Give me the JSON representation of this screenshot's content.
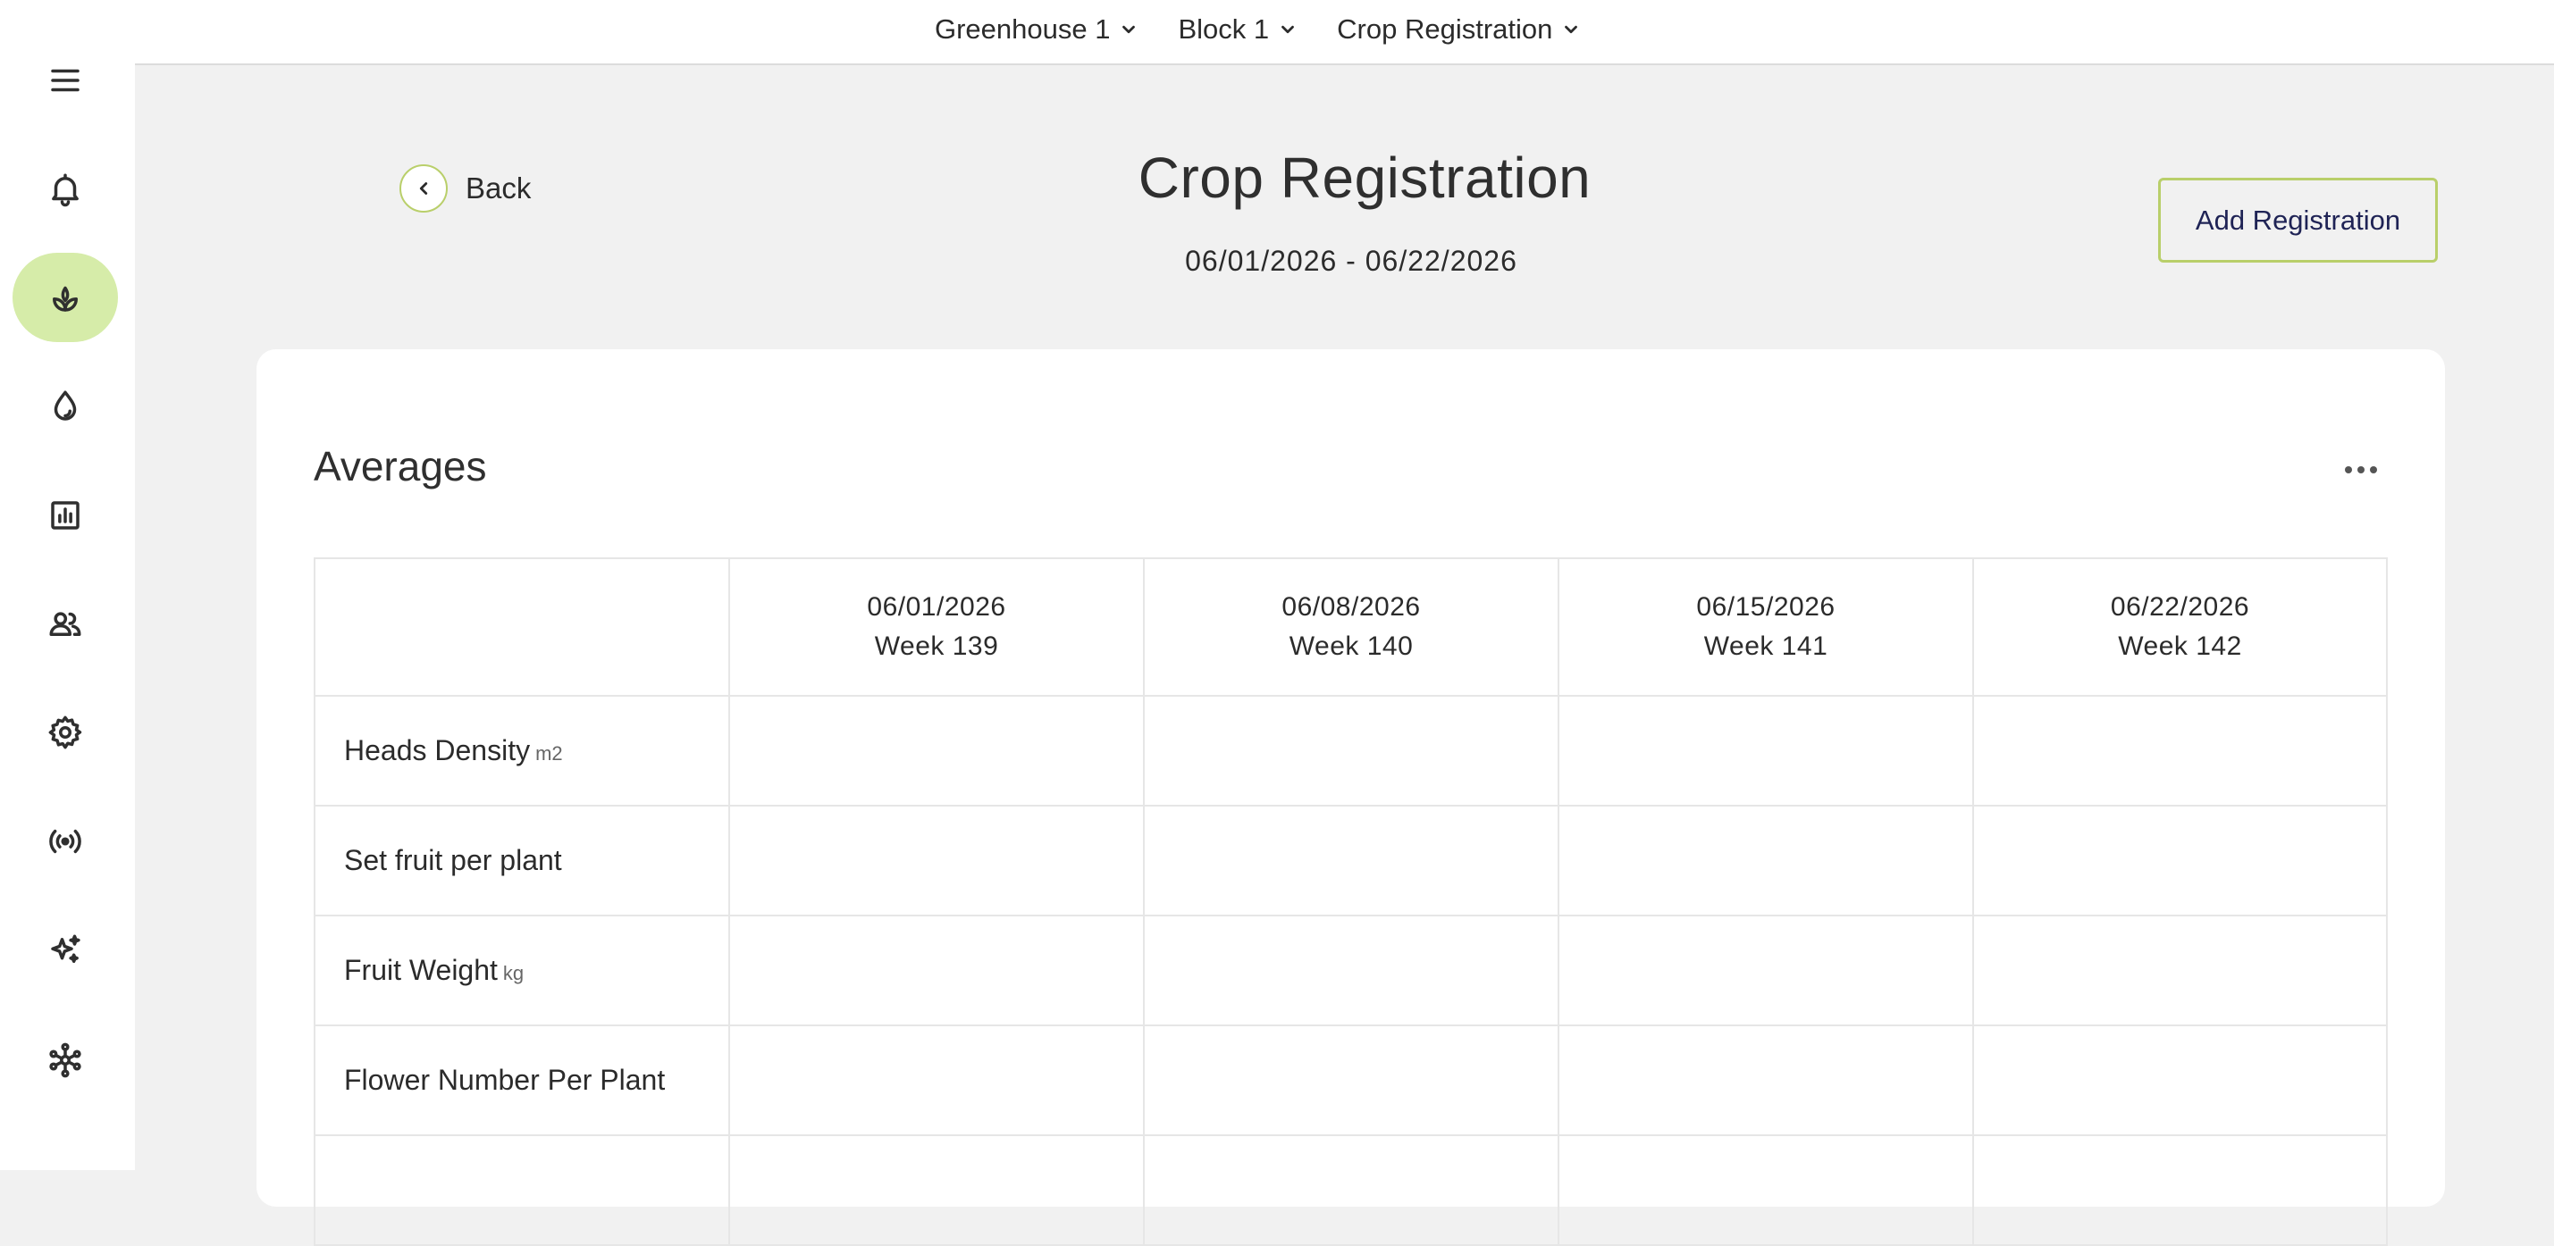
{
  "topbar": {
    "breadcrumbs": [
      {
        "label": "Greenhouse 1"
      },
      {
        "label": "Block 1"
      },
      {
        "label": "Crop Registration"
      }
    ]
  },
  "sidebar": {
    "items": [
      {
        "icon": "menu-icon",
        "active": false
      },
      {
        "icon": "bell-icon",
        "active": false
      },
      {
        "icon": "plant-icon",
        "active": true
      },
      {
        "icon": "water-drop-icon",
        "active": false
      },
      {
        "icon": "bar-chart-icon",
        "active": false
      },
      {
        "icon": "users-icon",
        "active": false
      },
      {
        "icon": "gear-icon",
        "active": false
      },
      {
        "icon": "broadcast-icon",
        "active": false
      },
      {
        "icon": "sparkles-icon",
        "active": false
      },
      {
        "icon": "network-icon",
        "active": false
      }
    ]
  },
  "header": {
    "back_label": "Back",
    "title": "Crop Registration",
    "date_range": "06/01/2026 - 06/22/2026",
    "add_button_label": "Add Registration"
  },
  "averages": {
    "title": "Averages",
    "columns": [
      {
        "date": "06/01/2026",
        "week": "Week 139"
      },
      {
        "date": "06/08/2026",
        "week": "Week 140"
      },
      {
        "date": "06/15/2026",
        "week": "Week 141"
      },
      {
        "date": "06/22/2026",
        "week": "Week 142"
      }
    ],
    "rows": [
      {
        "label": "Heads Density",
        "unit": "m2",
        "values": [
          "",
          "",
          "",
          ""
        ]
      },
      {
        "label": "Set fruit per plant",
        "unit": "",
        "values": [
          "",
          "",
          "",
          ""
        ]
      },
      {
        "label": "Fruit Weight",
        "unit": "kg",
        "values": [
          "",
          "",
          "",
          ""
        ]
      },
      {
        "label": "Flower Number Per Plant",
        "unit": "",
        "values": [
          "",
          "",
          "",
          ""
        ]
      },
      {
        "label": "",
        "unit": "",
        "values": [
          "",
          "",
          "",
          ""
        ]
      }
    ]
  },
  "colors": {
    "accent": "#d6eca9",
    "accent_border": "#b9cf6a",
    "button_text": "#1f2355",
    "background": "#f1f1f1"
  }
}
